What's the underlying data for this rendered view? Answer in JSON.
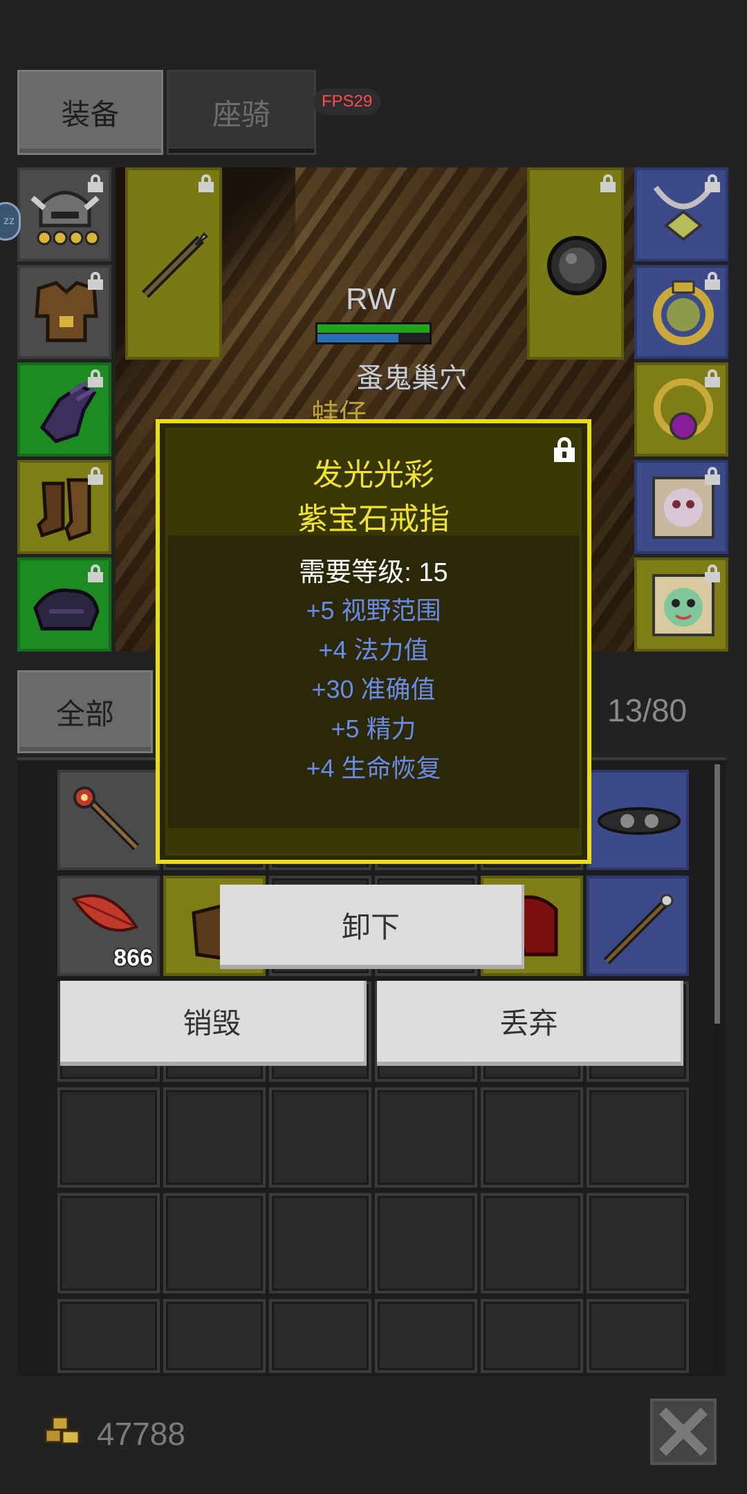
{
  "tabs": [
    {
      "label": "装备",
      "active": true
    },
    {
      "label": "座骑",
      "active": false
    }
  ],
  "fps": "FPS29",
  "side_badge": "zz",
  "character": {
    "name": "RW",
    "map_label": "蚤鬼巢穴",
    "npc_label": "蛙仔"
  },
  "equipment_slots": {
    "left": [
      {
        "icon": "helmet-icon",
        "rarity": "gray"
      },
      {
        "icon": "armor-icon",
        "rarity": "gray"
      },
      {
        "icon": "glove-icon",
        "rarity": "green"
      },
      {
        "icon": "boots-icon",
        "rarity": "yellow"
      },
      {
        "icon": "cloak-icon",
        "rarity": "green"
      }
    ],
    "weapon": {
      "icon": "spear-icon",
      "rarity": "yellow"
    },
    "offhand": {
      "icon": "shield-icon",
      "rarity": "yellow"
    },
    "right": [
      {
        "icon": "necklace-icon",
        "rarity": "blue"
      },
      {
        "icon": "ring-icon",
        "rarity": "blue"
      },
      {
        "icon": "purple-ring-icon",
        "rarity": "yellow"
      },
      {
        "icon": "pet-card-icon",
        "rarity": "blue"
      },
      {
        "icon": "frog-card-icon",
        "rarity": "yellow"
      }
    ]
  },
  "tooltip": {
    "prefix": "发光光彩",
    "item_name": "紫宝石戒指",
    "requirement": "需要等级: 15",
    "stats": [
      "+5 视野范围",
      "+4 法力值",
      "+30 准确值",
      "+5 精力",
      "+4 生命恢复"
    ],
    "colors": {
      "title": "#f1e334",
      "stat": "#6a8be6",
      "border": "#e9dd1a"
    }
  },
  "inventory": {
    "category_label": "全部",
    "capacity": "13/80",
    "items": [
      {
        "icon": "staff-icon",
        "rarity": "gray"
      },
      {
        "icon": "goggles-icon",
        "rarity": "blue"
      },
      {
        "icon": "leaf-icon",
        "rarity": "gray",
        "count": "866"
      },
      {
        "icon": "bag-icon",
        "rarity": "yellow"
      },
      {
        "icon": "helm-red-icon",
        "rarity": "yellow"
      },
      {
        "icon": "spear-icon",
        "rarity": "blue"
      }
    ]
  },
  "actions": {
    "unequip": "卸下",
    "destroy": "销毁",
    "drop": "丢弃"
  },
  "gold": "47788"
}
